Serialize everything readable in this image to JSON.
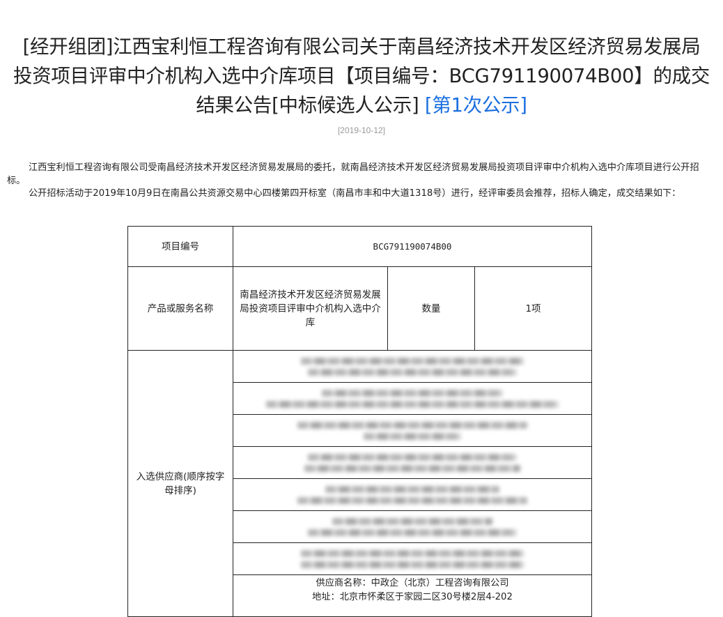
{
  "title": {
    "line1": "[经开组团]江西宝利恒工程咨询有限公司关于南昌经济技术开发区经济贸易发展局",
    "line2": "投资项目评审中介机构入选中介库项目【项目编号：BCG791190074B00】的成交",
    "line3_text": "结果公告[中标候选人公示]",
    "line3_link": "[第1次公示]"
  },
  "date": "[2019-10-12]",
  "intro": {
    "p1": "江西宝利恒工程咨询有限公司受南昌经济技术开发区经济贸易发展局的委托，就南昌经济技术开发区经济贸易发展局投资项目评审中介机构入选中介库项目进行公开招标。",
    "p2": "公开招标活动于2019年10月9日在南昌公共资源交易中心四楼第四开标室（南昌市丰和中大道1318号）进行，经评审委员会推荐，招标人确定，成交结果如下："
  },
  "table": {
    "project_no_label": "项目编号",
    "project_no_value": "BCG791190074B00",
    "product_label": "产品或服务名称",
    "product_value": "南昌经济技术开发区经济贸易发展局投资项目评审中介机构入选中介库",
    "qty_label": "数量",
    "qty_value": "1项",
    "suppliers_label": "入选供应商(顺序按字母排序)",
    "last_supplier_name": "供应商名称：中政企（北京）工程咨询有限公司",
    "last_supplier_addr": "地址：北京市怀柔区于家园二区30号楼2层4-202"
  }
}
